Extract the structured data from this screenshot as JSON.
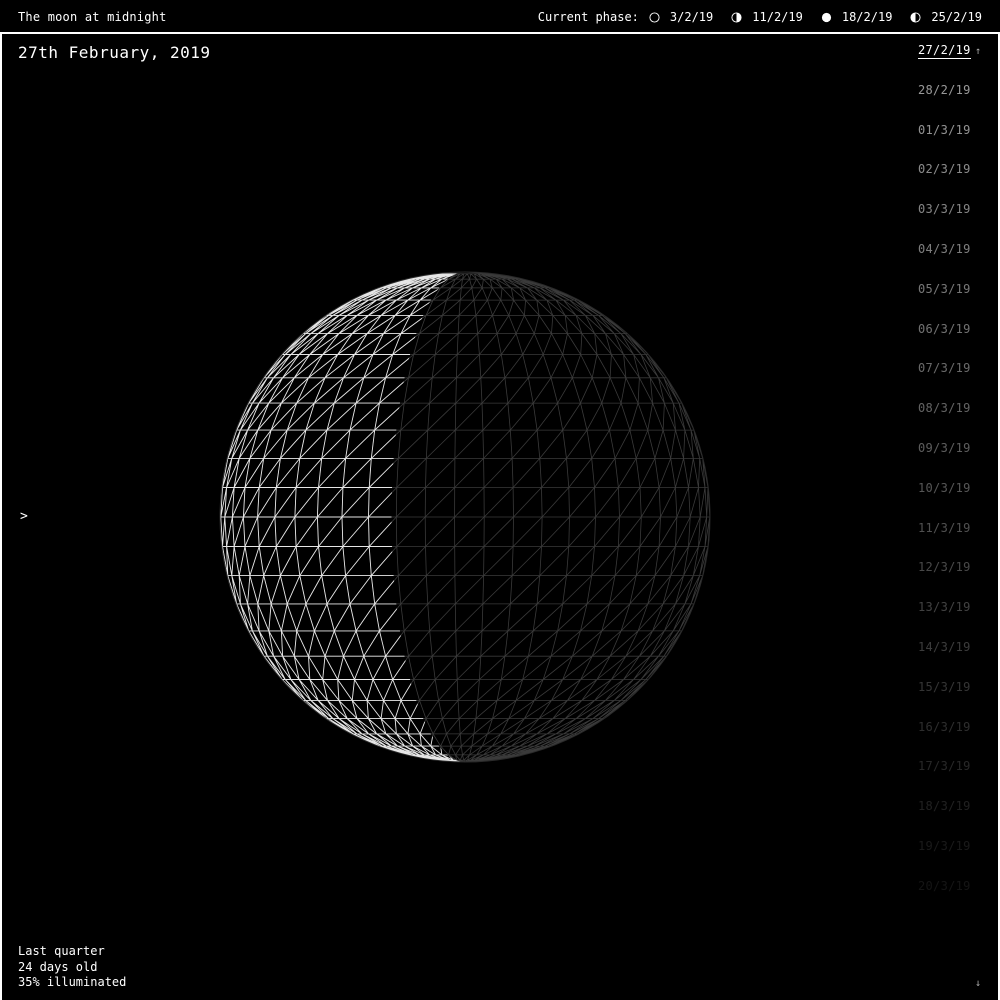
{
  "app": {
    "title": "The moon at midnight"
  },
  "phases": {
    "label": "Current phase:",
    "items": [
      {
        "icon": "new-moon-icon",
        "date": "3/2/19"
      },
      {
        "icon": "first-quarter-icon",
        "date": "11/2/19"
      },
      {
        "icon": "full-moon-icon",
        "date": "18/2/19"
      },
      {
        "icon": "last-quarter-icon",
        "date": "25/2/19"
      }
    ]
  },
  "current": {
    "long_date": "27th February, 2019",
    "phase_name": "Last quarter",
    "age": "24 days old",
    "illumination_text": "35% illuminated",
    "illuminated_fraction": 0.35
  },
  "toggle": {
    "symbol": ">"
  },
  "date_list": {
    "selected": "27/2/19",
    "items": [
      "27/2/19",
      "28/2/19",
      "01/3/19",
      "02/3/19",
      "03/3/19",
      "04/3/19",
      "05/3/19",
      "06/3/19",
      "07/3/19",
      "08/3/19",
      "09/3/19",
      "10/3/19",
      "11/3/19",
      "12/3/19",
      "13/3/19",
      "14/3/19",
      "15/3/19",
      "16/3/19",
      "17/3/19",
      "18/3/19",
      "19/3/19",
      "20/3/19"
    ],
    "scroll_up": "↑",
    "scroll_down": "↓"
  },
  "colors": {
    "background": "#000000",
    "foreground": "#ffffff"
  }
}
